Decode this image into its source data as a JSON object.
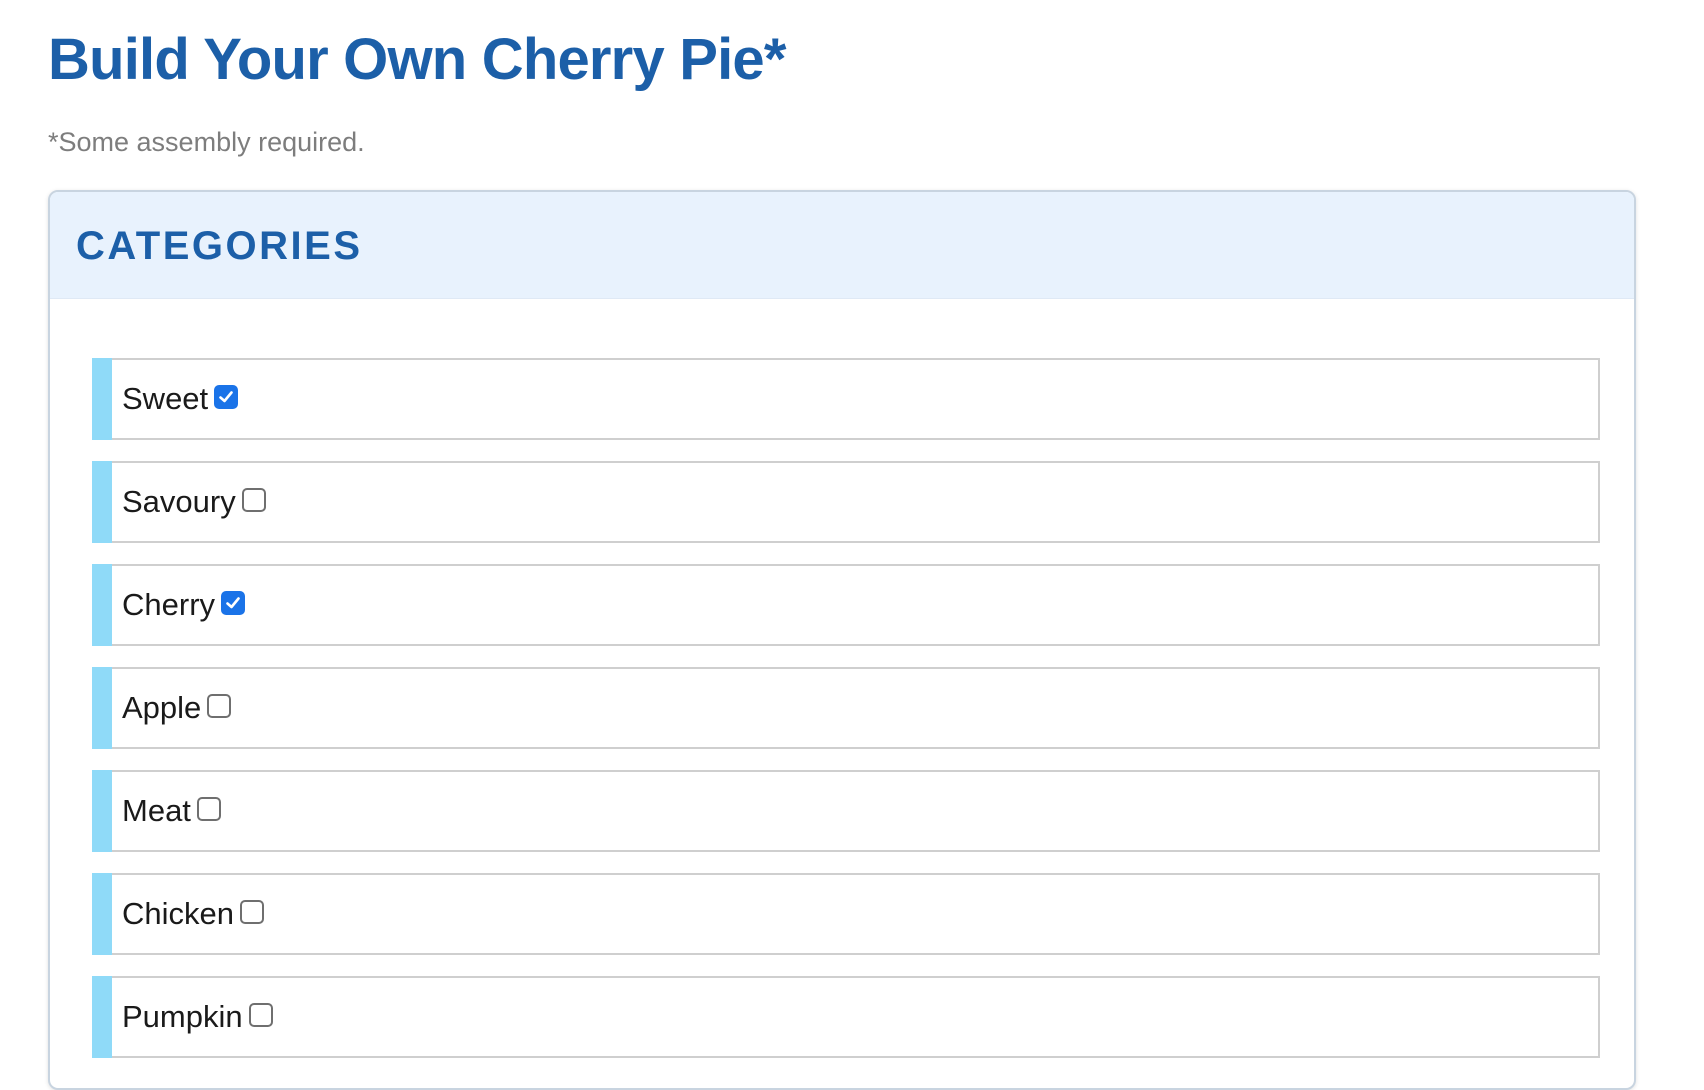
{
  "page": {
    "title": "Build Your Own Cherry Pie*",
    "subtitle": "*Some assembly required."
  },
  "panel": {
    "title": "CATEGORIES"
  },
  "categories": [
    {
      "label": "Sweet",
      "checked": true
    },
    {
      "label": "Savoury",
      "checked": false
    },
    {
      "label": "Cherry",
      "checked": true
    },
    {
      "label": "Apple",
      "checked": false
    },
    {
      "label": "Meat",
      "checked": false
    },
    {
      "label": "Chicken",
      "checked": false
    },
    {
      "label": "Pumpkin",
      "checked": false
    }
  ],
  "colors": {
    "heading": "#1c5fa8",
    "header_bg": "#e8f2fd",
    "accent_bar": "#8fdaf8",
    "checkbox_checked": "#1a73e8"
  }
}
